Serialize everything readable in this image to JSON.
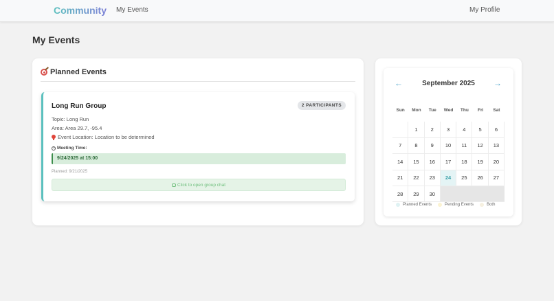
{
  "nav": {
    "brand": "Community",
    "my_events": "My Events",
    "my_profile": "My Profile"
  },
  "page": {
    "title": "My Events"
  },
  "planned_section": {
    "title": "Planned Events"
  },
  "event": {
    "name": "Long Run Group",
    "participants_badge": "2 PARTICIPANTS",
    "topic": "Topic: Long Run",
    "area": "Area: Area 29.7, -95.4",
    "location": "Event Location: Location to be determined",
    "meeting_time_label": "Meeting Time:",
    "meeting_time": "9/24/2025 at 15:00",
    "planned_date": "Planned: 9/21/2025",
    "chat_button": "Click to open group chat"
  },
  "calendar": {
    "prev": "←",
    "next": "→",
    "month": "September 2025",
    "dow": [
      "Sun",
      "Mon",
      "Tue",
      "Wed",
      "Thu",
      "Fri",
      "Sat"
    ],
    "weeks": [
      [
        "",
        "1",
        "2",
        "3",
        "4",
        "5",
        "6"
      ],
      [
        "7",
        "8",
        "9",
        "10",
        "11",
        "12",
        "13"
      ],
      [
        "14",
        "15",
        "16",
        "17",
        "18",
        "19",
        "20"
      ],
      [
        "21",
        "22",
        "23",
        "24",
        "25",
        "26",
        "27"
      ],
      [
        "28",
        "29",
        "30"
      ]
    ],
    "today": "24",
    "legend": [
      {
        "label": "Planned Events",
        "color": "#dff2f3"
      },
      {
        "label": "Pending Events",
        "color": "#fbf3d2"
      },
      {
        "label": "Both",
        "color": "#f6f0e0"
      }
    ]
  },
  "colors": {
    "accent": "#5bc0be",
    "meeting_bg": "#d8eddc",
    "chat_text": "#6fbf7d"
  }
}
